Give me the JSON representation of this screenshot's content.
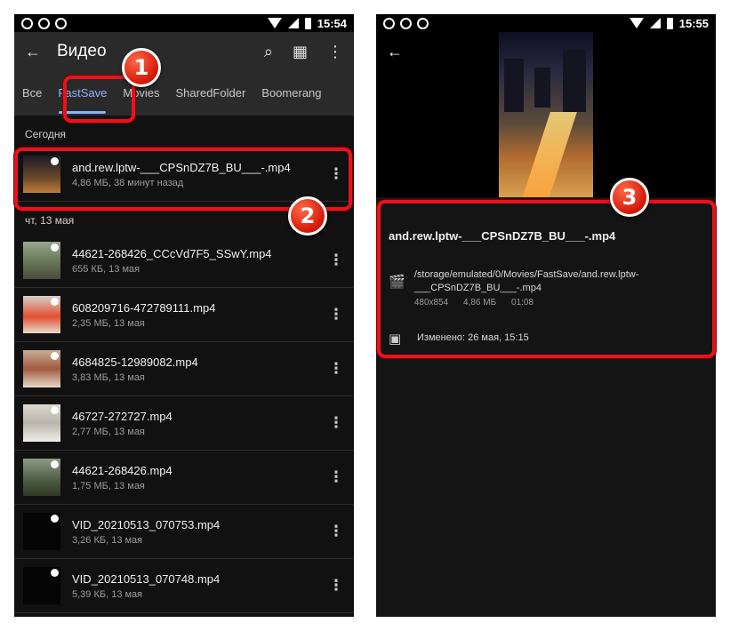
{
  "left": {
    "status": {
      "time": "15:54"
    },
    "appbar": {
      "title": "Видео"
    },
    "tabs": [
      "Все",
      "FastSave",
      "Movies",
      "SharedFolder",
      "Boomerang"
    ],
    "sections": [
      {
        "header": "Сегодня",
        "files": [
          {
            "name": "and.rew.lptw-___CPSnDZ7B_BU___-.mp4",
            "sub": "4,86 МБ, 38 минут назад"
          }
        ]
      },
      {
        "header": "чт, 13 мая",
        "files": [
          {
            "name": "44621-268426_CCcVd7F5_SSwY.mp4",
            "sub": "655 КБ, 13 мая"
          },
          {
            "name": "608209716-472789111.mp4",
            "sub": "2,35 МБ, 13 мая"
          },
          {
            "name": "4684825-12989082.mp4",
            "sub": "3,83 МБ, 13 мая"
          },
          {
            "name": "46727-272727.mp4",
            "sub": "2,77 МБ, 13 мая"
          },
          {
            "name": "44621-268426.mp4",
            "sub": "1,75 МБ, 13 мая"
          },
          {
            "name": "VID_20210513_070753.mp4",
            "sub": "3,26 КБ, 13 мая"
          },
          {
            "name": "VID_20210513_070748.mp4",
            "sub": "5,39 КБ, 13 мая"
          }
        ]
      }
    ]
  },
  "right": {
    "status": {
      "time": "15:55"
    },
    "details": {
      "title": "and.rew.lptw-___CPSnDZ7B_BU___-.mp4",
      "path": "/storage/emulated/0/Movies/FastSave/and.rew.lptw-___CPSnDZ7B_BU___-.mp4",
      "resolution": "480x854",
      "size": "4,86 МБ",
      "duration": "01:08",
      "modified": "Изменено: 26 мая, 15:15"
    }
  },
  "callouts": [
    "1",
    "2",
    "3"
  ],
  "colors": {
    "accent": "#8ab4f8",
    "callout": "#e8121d",
    "appbar": "#2a2a2a"
  }
}
